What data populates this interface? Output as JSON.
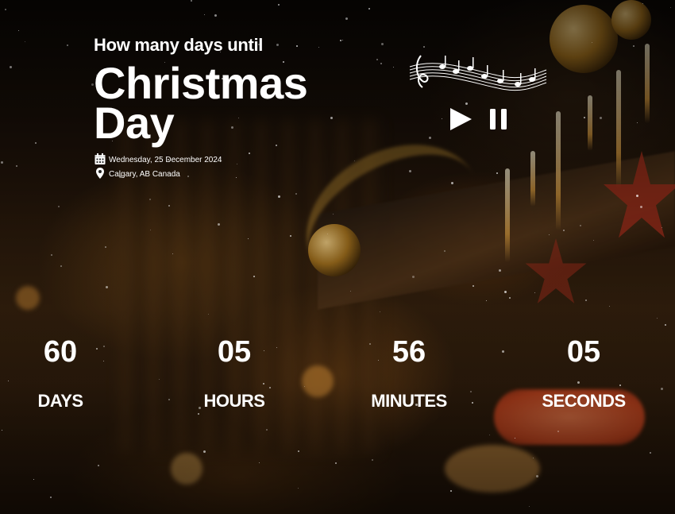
{
  "header": {
    "pre_title": "How many days until",
    "title": "Christmas Day",
    "date": "Wednesday, 25 December 2024",
    "location": "Calgary, AB Canada"
  },
  "icons": {
    "calendar": "calendar-icon",
    "location": "map-pin-icon",
    "music": "music-notes-icon",
    "play": "play-icon",
    "pause": "pause-icon"
  },
  "countdown": [
    {
      "value": "60",
      "label": "DAYS"
    },
    {
      "value": "05",
      "label": "HOURS"
    },
    {
      "value": "56",
      "label": "MINUTES"
    },
    {
      "value": "05",
      "label": "SECONDS"
    }
  ],
  "colors": {
    "text": "#ffffff",
    "warm_glow": "#e0a040",
    "red_accent": "#d04820"
  }
}
